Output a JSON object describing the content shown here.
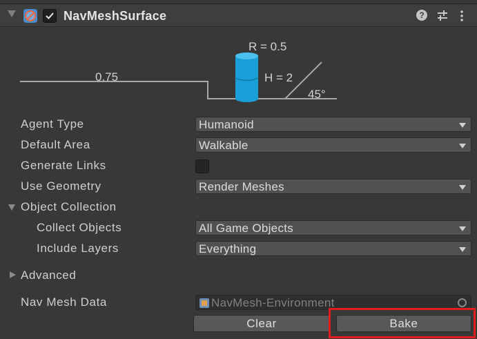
{
  "component": {
    "title": "NavMeshSurface",
    "help_glyph": "?"
  },
  "diagram": {
    "step_height": "0.75",
    "radius": "R = 0.5",
    "height": "H = 2",
    "slope": "45°"
  },
  "fields": {
    "agent_type": {
      "label": "Agent Type",
      "value": "Humanoid"
    },
    "default_area": {
      "label": "Default Area",
      "value": "Walkable"
    },
    "generate_links": {
      "label": "Generate Links",
      "checked": false
    },
    "use_geometry": {
      "label": "Use Geometry",
      "value": "Render Meshes"
    },
    "object_collection": {
      "label": "Object Collection",
      "expanded": true
    },
    "collect_objects": {
      "label": "Collect Objects",
      "value": "All Game Objects"
    },
    "include_layers": {
      "label": "Include Layers",
      "value": "Everything"
    },
    "advanced": {
      "label": "Advanced",
      "expanded": false
    },
    "nav_mesh_data": {
      "label": "Nav Mesh Data",
      "value": "NavMesh-Environment"
    }
  },
  "buttons": {
    "clear": "Clear",
    "bake": "Bake"
  },
  "colors": {
    "agent_cylinder": "#1a9fd8",
    "highlight": "#e11d1d"
  }
}
